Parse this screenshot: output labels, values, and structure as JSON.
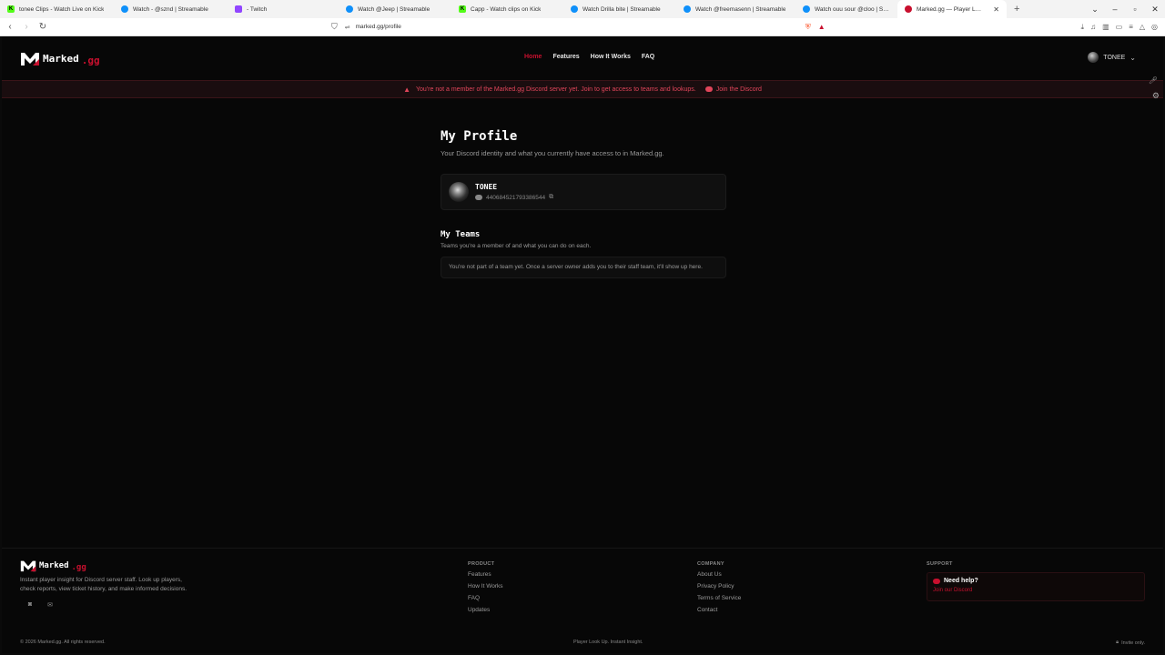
{
  "browser": {
    "tabs": [
      {
        "label": "tonee Clips - Watch Live on Kick",
        "icon": "kick-icon",
        "active": false
      },
      {
        "label": "Watch - @sznd | Streamable",
        "icon": "streamable-icon",
        "active": false
      },
      {
        "label": "- Twitch",
        "icon": "twitch-icon",
        "active": false
      },
      {
        "label": "Watch @Jeep | Streamable",
        "icon": "streamable-icon",
        "active": false
      },
      {
        "label": "Capp - Watch clips on Kick",
        "icon": "kick-icon",
        "active": false
      },
      {
        "label": "Watch Drilla bite | Streamable",
        "icon": "streamable-icon",
        "active": false
      },
      {
        "label": "Watch @freemasenn | Streamable",
        "icon": "streamable-icon",
        "active": false
      },
      {
        "label": "Watch ouu sour @cloo | Streamable",
        "icon": "streamable-icon",
        "active": false
      },
      {
        "label": "Marked.gg — Player Look Up, In",
        "icon": "marked-icon",
        "active": true
      }
    ],
    "url": "marked.gg/profile"
  },
  "header": {
    "logo_text": "Marked",
    "logo_suffix": ".gg",
    "nav": [
      {
        "label": "Home",
        "active": true
      },
      {
        "label": "Features",
        "active": false
      },
      {
        "label": "How It Works",
        "active": false
      },
      {
        "label": "FAQ",
        "active": false
      }
    ],
    "username": "TONEE"
  },
  "banner": {
    "message": "You're not a member of the Marked.gg Discord server yet. Join to get access to teams and lookups.",
    "link": "Join the Discord"
  },
  "profile": {
    "title": "My Profile",
    "subtitle": "Your Discord identity and what you currently have access to in Marked.gg.",
    "name": "TONEE",
    "discord_id": "440684521793386544"
  },
  "teams": {
    "title": "My Teams",
    "subtitle": "Teams you're a member of and what you can do on each.",
    "empty": "You're not part of a team yet. Once a server owner adds you to their staff team, it'll show up here."
  },
  "footer": {
    "description": "Instant player insight for Discord server staff. Look up players, check reports, view ticket history, and make informed decisions.",
    "product": {
      "heading": "PRODUCT",
      "links": [
        "Features",
        "How It Works",
        "FAQ",
        "Updates"
      ]
    },
    "company": {
      "heading": "COMPANY",
      "links": [
        "About Us",
        "Privacy Policy",
        "Terms of Service",
        "Contact"
      ]
    },
    "support": {
      "heading": "SUPPORT",
      "help_title": "Need help?",
      "help_link": "Join our Discord"
    },
    "copyright": "© 2026 Marked.gg. All rights reserved.",
    "tagline": "Player Look Up. Instant Insight.",
    "invite": "Invite only."
  },
  "colors": {
    "accent": "#c8102e",
    "background": "#070707"
  }
}
